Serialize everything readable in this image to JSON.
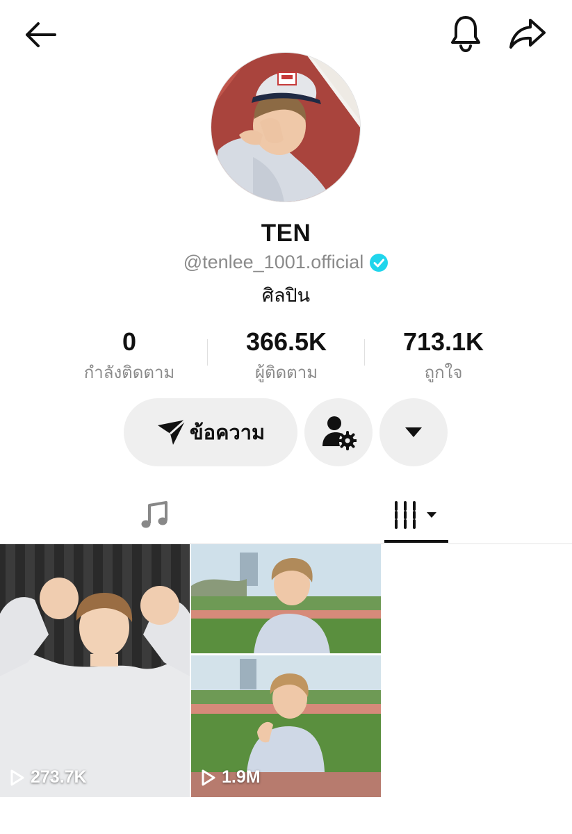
{
  "header": {
    "back_icon": "arrow-left-icon",
    "notify_icon": "bell-icon",
    "share_icon": "share-arrow-icon"
  },
  "profile": {
    "display_name": "TEN",
    "username": "@tenlee_1001.official",
    "verified": true,
    "verified_color": "#20d5ec",
    "bio": "ศิลปิน"
  },
  "stats": [
    {
      "value": "0",
      "label": "กำลังติดตาม"
    },
    {
      "value": "366.5K",
      "label": "ผู้ติดตาม"
    },
    {
      "value": "713.1K",
      "label": "ถูกใจ"
    }
  ],
  "actions": {
    "message_label": "ข้อความ",
    "message_icon": "send-icon",
    "friends_icon": "person-gear-icon",
    "more_icon": "caret-down-icon"
  },
  "tabs": [
    {
      "name": "music",
      "icon": "music-note-icon",
      "active": false
    },
    {
      "name": "videos",
      "icon": "grid-lines-icon",
      "active": true
    }
  ],
  "videos": [
    {
      "views": "273.7K"
    },
    {
      "views": "1.9M"
    }
  ]
}
